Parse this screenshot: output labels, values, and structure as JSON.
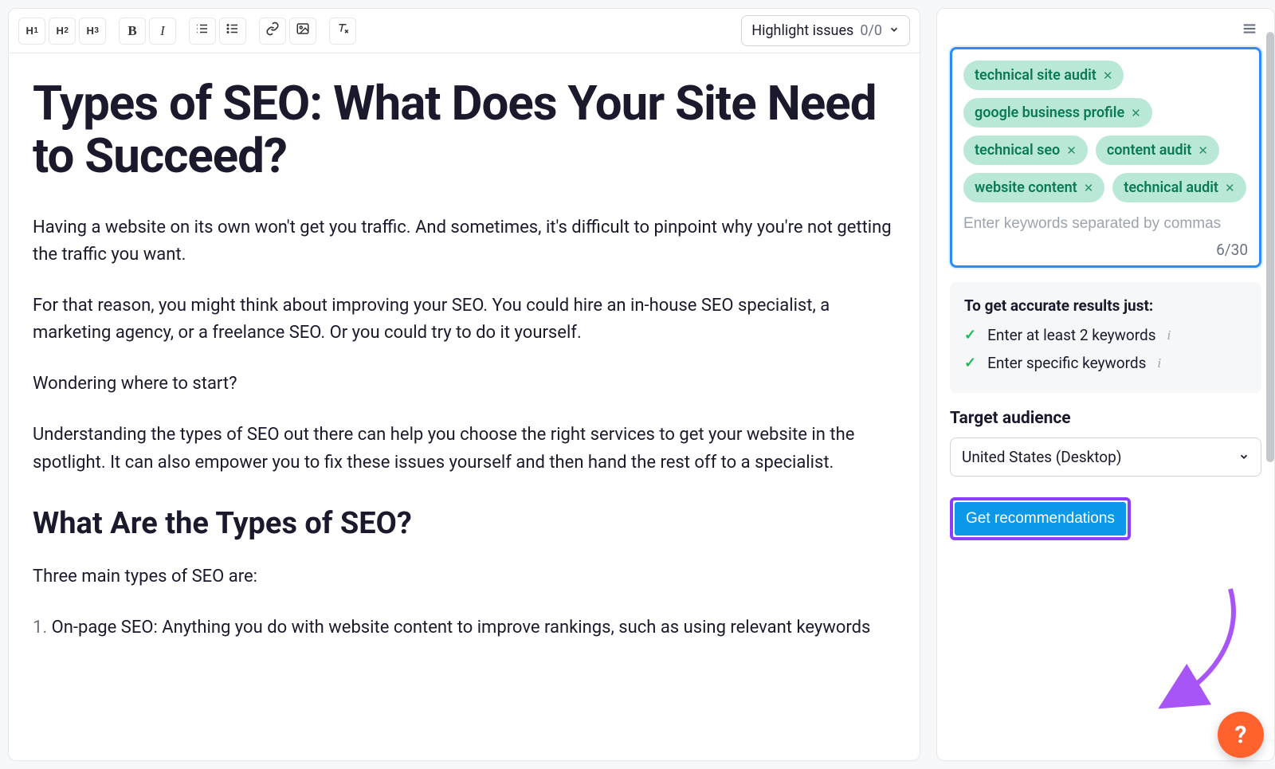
{
  "toolbar": {
    "highlight_label": "Highlight issues",
    "highlight_count": "0/0"
  },
  "article": {
    "title": "Types of SEO: What Does Your Site Need to Succeed?",
    "p1": "Having a website on its own won't get you traffic. And sometimes, it's difficult to pinpoint why you're not getting the traffic you want.",
    "p2": "For that reason, you might think about improving your SEO. You could hire an in-house SEO specialist, a marketing agency, or a freelance SEO. Or you could try to do it yourself.",
    "p3": "Wondering where to start?",
    "p4": "Understanding the types of SEO out there can help you choose the right services to get your website in the spotlight. It can also empower you to fix these issues yourself and then hand the rest off to a specialist.",
    "h2": "What Are the Types of SEO?",
    "p5": "Three main types of SEO are:",
    "li1_num": "1. ",
    "li1": "On-page SEO: Anything you do with website content to improve rankings, such as using relevant keywords"
  },
  "sidebar": {
    "keywords": [
      "technical site audit",
      "google business profile",
      "technical seo",
      "content audit",
      "website content",
      "technical audit"
    ],
    "placeholder": "Enter keywords separated by commas",
    "count": "6/30",
    "hint_title": "To get accurate results just:",
    "hint1": "Enter at least 2 keywords",
    "hint2": "Enter specific keywords",
    "audience_label": "Target audience",
    "audience_value": "United States (Desktop)",
    "cta": "Get recommendations"
  },
  "help": "?"
}
